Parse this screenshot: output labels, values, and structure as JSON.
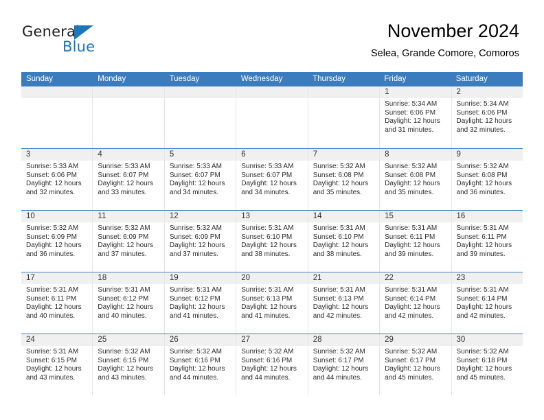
{
  "logo": {
    "word_one": "General",
    "word_two": "Blue",
    "triangle_color": "#1b76bc"
  },
  "header": {
    "title": "November 2024",
    "subtitle": "Selea, Grande Comore, Comoros"
  },
  "theme": {
    "header_blue": "#3a7cbe",
    "day_band_gray": "#f0f0f0",
    "cell_border": "#e6e6e6"
  },
  "weekdays": [
    "Sunday",
    "Monday",
    "Tuesday",
    "Wednesday",
    "Thursday",
    "Friday",
    "Saturday"
  ],
  "weeks": [
    [
      {
        "day": "",
        "sunrise": "",
        "sunset": "",
        "daylight": "",
        "empty": true
      },
      {
        "day": "",
        "sunrise": "",
        "sunset": "",
        "daylight": "",
        "empty": true
      },
      {
        "day": "",
        "sunrise": "",
        "sunset": "",
        "daylight": "",
        "empty": true
      },
      {
        "day": "",
        "sunrise": "",
        "sunset": "",
        "daylight": "",
        "empty": true
      },
      {
        "day": "",
        "sunrise": "",
        "sunset": "",
        "daylight": "",
        "empty": true
      },
      {
        "day": "1",
        "sunrise": "Sunrise: 5:34 AM",
        "sunset": "Sunset: 6:06 PM",
        "daylight": "Daylight: 12 hours and 31 minutes."
      },
      {
        "day": "2",
        "sunrise": "Sunrise: 5:34 AM",
        "sunset": "Sunset: 6:06 PM",
        "daylight": "Daylight: 12 hours and 32 minutes."
      }
    ],
    [
      {
        "day": "3",
        "sunrise": "Sunrise: 5:33 AM",
        "sunset": "Sunset: 6:06 PM",
        "daylight": "Daylight: 12 hours and 32 minutes."
      },
      {
        "day": "4",
        "sunrise": "Sunrise: 5:33 AM",
        "sunset": "Sunset: 6:07 PM",
        "daylight": "Daylight: 12 hours and 33 minutes."
      },
      {
        "day": "5",
        "sunrise": "Sunrise: 5:33 AM",
        "sunset": "Sunset: 6:07 PM",
        "daylight": "Daylight: 12 hours and 34 minutes."
      },
      {
        "day": "6",
        "sunrise": "Sunrise: 5:33 AM",
        "sunset": "Sunset: 6:07 PM",
        "daylight": "Daylight: 12 hours and 34 minutes."
      },
      {
        "day": "7",
        "sunrise": "Sunrise: 5:32 AM",
        "sunset": "Sunset: 6:08 PM",
        "daylight": "Daylight: 12 hours and 35 minutes."
      },
      {
        "day": "8",
        "sunrise": "Sunrise: 5:32 AM",
        "sunset": "Sunset: 6:08 PM",
        "daylight": "Daylight: 12 hours and 35 minutes."
      },
      {
        "day": "9",
        "sunrise": "Sunrise: 5:32 AM",
        "sunset": "Sunset: 6:08 PM",
        "daylight": "Daylight: 12 hours and 36 minutes."
      }
    ],
    [
      {
        "day": "10",
        "sunrise": "Sunrise: 5:32 AM",
        "sunset": "Sunset: 6:09 PM",
        "daylight": "Daylight: 12 hours and 36 minutes."
      },
      {
        "day": "11",
        "sunrise": "Sunrise: 5:32 AM",
        "sunset": "Sunset: 6:09 PM",
        "daylight": "Daylight: 12 hours and 37 minutes."
      },
      {
        "day": "12",
        "sunrise": "Sunrise: 5:32 AM",
        "sunset": "Sunset: 6:09 PM",
        "daylight": "Daylight: 12 hours and 37 minutes."
      },
      {
        "day": "13",
        "sunrise": "Sunrise: 5:31 AM",
        "sunset": "Sunset: 6:10 PM",
        "daylight": "Daylight: 12 hours and 38 minutes."
      },
      {
        "day": "14",
        "sunrise": "Sunrise: 5:31 AM",
        "sunset": "Sunset: 6:10 PM",
        "daylight": "Daylight: 12 hours and 38 minutes."
      },
      {
        "day": "15",
        "sunrise": "Sunrise: 5:31 AM",
        "sunset": "Sunset: 6:11 PM",
        "daylight": "Daylight: 12 hours and 39 minutes."
      },
      {
        "day": "16",
        "sunrise": "Sunrise: 5:31 AM",
        "sunset": "Sunset: 6:11 PM",
        "daylight": "Daylight: 12 hours and 39 minutes."
      }
    ],
    [
      {
        "day": "17",
        "sunrise": "Sunrise: 5:31 AM",
        "sunset": "Sunset: 6:11 PM",
        "daylight": "Daylight: 12 hours and 40 minutes."
      },
      {
        "day": "18",
        "sunrise": "Sunrise: 5:31 AM",
        "sunset": "Sunset: 6:12 PM",
        "daylight": "Daylight: 12 hours and 40 minutes."
      },
      {
        "day": "19",
        "sunrise": "Sunrise: 5:31 AM",
        "sunset": "Sunset: 6:12 PM",
        "daylight": "Daylight: 12 hours and 41 minutes."
      },
      {
        "day": "20",
        "sunrise": "Sunrise: 5:31 AM",
        "sunset": "Sunset: 6:13 PM",
        "daylight": "Daylight: 12 hours and 41 minutes."
      },
      {
        "day": "21",
        "sunrise": "Sunrise: 5:31 AM",
        "sunset": "Sunset: 6:13 PM",
        "daylight": "Daylight: 12 hours and 42 minutes."
      },
      {
        "day": "22",
        "sunrise": "Sunrise: 5:31 AM",
        "sunset": "Sunset: 6:14 PM",
        "daylight": "Daylight: 12 hours and 42 minutes."
      },
      {
        "day": "23",
        "sunrise": "Sunrise: 5:31 AM",
        "sunset": "Sunset: 6:14 PM",
        "daylight": "Daylight: 12 hours and 42 minutes."
      }
    ],
    [
      {
        "day": "24",
        "sunrise": "Sunrise: 5:31 AM",
        "sunset": "Sunset: 6:15 PM",
        "daylight": "Daylight: 12 hours and 43 minutes."
      },
      {
        "day": "25",
        "sunrise": "Sunrise: 5:32 AM",
        "sunset": "Sunset: 6:15 PM",
        "daylight": "Daylight: 12 hours and 43 minutes."
      },
      {
        "day": "26",
        "sunrise": "Sunrise: 5:32 AM",
        "sunset": "Sunset: 6:16 PM",
        "daylight": "Daylight: 12 hours and 44 minutes."
      },
      {
        "day": "27",
        "sunrise": "Sunrise: 5:32 AM",
        "sunset": "Sunset: 6:16 PM",
        "daylight": "Daylight: 12 hours and 44 minutes."
      },
      {
        "day": "28",
        "sunrise": "Sunrise: 5:32 AM",
        "sunset": "Sunset: 6:17 PM",
        "daylight": "Daylight: 12 hours and 44 minutes."
      },
      {
        "day": "29",
        "sunrise": "Sunrise: 5:32 AM",
        "sunset": "Sunset: 6:17 PM",
        "daylight": "Daylight: 12 hours and 45 minutes."
      },
      {
        "day": "30",
        "sunrise": "Sunrise: 5:32 AM",
        "sunset": "Sunset: 6:18 PM",
        "daylight": "Daylight: 12 hours and 45 minutes."
      }
    ]
  ]
}
